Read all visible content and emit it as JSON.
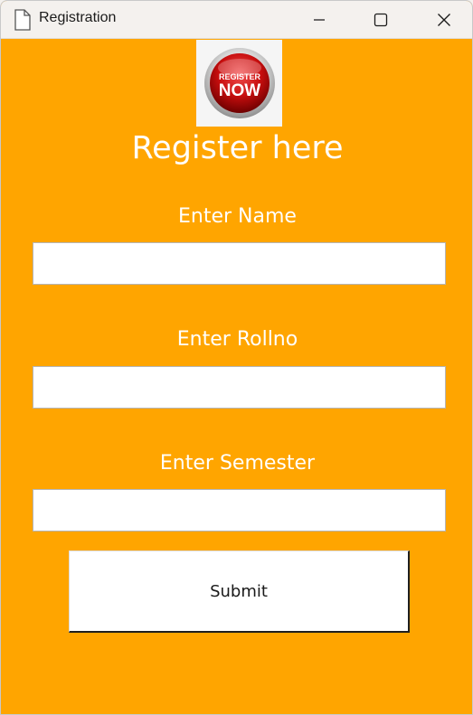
{
  "window": {
    "title": "Registration"
  },
  "logo": {
    "line1": "REGISTER",
    "line2": "NOW"
  },
  "form": {
    "heading": "Register here",
    "name_label": "Enter Name",
    "name_value": "",
    "rollno_label": "Enter Rollno",
    "rollno_value": "",
    "semester_label": "Enter Semester",
    "semester_value": "",
    "submit_label": "Submit"
  },
  "icons": {
    "app": "document-icon",
    "minimize": "minimize-icon",
    "maximize": "maximize-icon",
    "close": "close-icon"
  },
  "colors": {
    "background": "#ffa500",
    "titlebar": "#f4f1ee",
    "text": "#ffffff",
    "field": "#ffffff"
  }
}
